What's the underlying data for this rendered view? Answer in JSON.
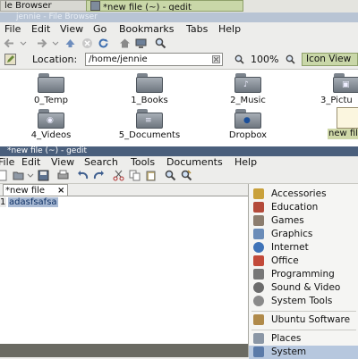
{
  "taskbar": {
    "file_browser_label": "le Browser",
    "gedit_label": "*new file (~) - gedit"
  },
  "file_browser": {
    "title": "jennie - File Browser",
    "menu": [
      "File",
      "Edit",
      "View",
      "Go",
      "Bookmarks",
      "Tabs",
      "Help"
    ],
    "location_label": "Location:",
    "location_value": "/home/jennie",
    "zoom": "100%",
    "view_mode": "Icon View",
    "items": [
      {
        "label": "0_Temp",
        "icon": "folder-icon"
      },
      {
        "label": "1_Books",
        "icon": "folder-icon"
      },
      {
        "label": "2_Music",
        "icon": "music-folder-icon"
      },
      {
        "label": "3_Pictu",
        "icon": "pictures-folder-icon"
      },
      {
        "label": "4_Videos",
        "icon": "videos-folder-icon"
      },
      {
        "label": "5_Documents",
        "icon": "documents-folder-icon"
      },
      {
        "label": "Dropbox",
        "icon": "dropbox-folder-icon"
      },
      {
        "label": "new fil",
        "icon": "text-file-icon"
      }
    ]
  },
  "gedit": {
    "title": "*new file (~) - gedit",
    "menu": [
      "File",
      "Edit",
      "View",
      "Search",
      "Tools",
      "Documents",
      "Help"
    ],
    "tab_label": "*new file",
    "tab_close": "×",
    "line_number": "1",
    "line_text": "adasfsafsa"
  },
  "app_menu": {
    "items": [
      {
        "label": "Accessories",
        "icon": "accessories-icon",
        "color": "#c9a13b"
      },
      {
        "label": "Education",
        "icon": "education-icon",
        "color": "#b44a3a"
      },
      {
        "label": "Games",
        "icon": "games-icon",
        "color": "#8c7d6e"
      },
      {
        "label": "Graphics",
        "icon": "graphics-icon",
        "color": "#6a8cb8"
      },
      {
        "label": "Internet",
        "icon": "internet-icon",
        "color": "#3f73b8"
      },
      {
        "label": "Office",
        "icon": "office-icon",
        "color": "#c24a3a"
      },
      {
        "label": "Programming",
        "icon": "programming-icon",
        "color": "#777777"
      },
      {
        "label": "Sound & Video",
        "icon": "sound-video-icon",
        "color": "#6b6b6b"
      },
      {
        "label": "System Tools",
        "icon": "system-tools-icon",
        "color": "#8a8a8a"
      },
      {
        "label": "Ubuntu Software",
        "icon": "ubuntu-software-icon",
        "color": "#b08a4a"
      },
      {
        "label": "Places",
        "icon": "places-icon",
        "color": "#8a96a5"
      },
      {
        "label": "System",
        "icon": "system-icon",
        "color": "#5a7aa8"
      }
    ]
  }
}
